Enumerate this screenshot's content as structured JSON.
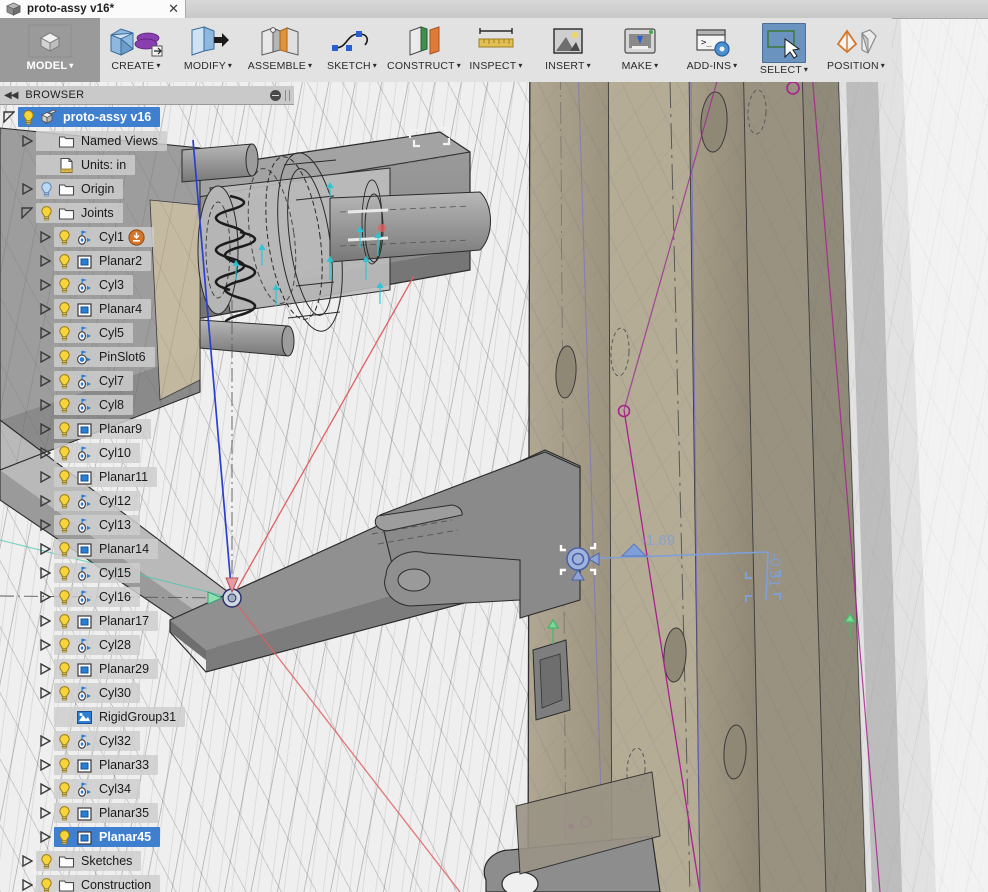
{
  "window": {
    "tab": {
      "title": "proto-assy v16*",
      "doc_icon": "cube-document-icon",
      "close_icon": "close-icon"
    }
  },
  "ribbon": {
    "workspace": {
      "label": "MODEL",
      "icon": "cube-icon",
      "caret": "▾"
    },
    "buttons": [
      {
        "label": "CREATE",
        "icon": "create-solid-icon",
        "caret": "▾",
        "selected": false
      },
      {
        "label": "MODIFY",
        "icon": "modify-press-pull-icon",
        "caret": "▾",
        "selected": false
      },
      {
        "label": "ASSEMBLE",
        "icon": "assemble-joint-icon",
        "caret": "▾",
        "selected": false
      },
      {
        "label": "SKETCH",
        "icon": "sketch-spline-icon",
        "caret": "▾",
        "selected": false
      },
      {
        "label": "CONSTRUCT",
        "icon": "construct-plane-icon",
        "caret": "▾",
        "selected": false
      },
      {
        "label": "INSPECT",
        "icon": "inspect-measure-icon",
        "caret": "▾",
        "selected": false
      },
      {
        "label": "INSERT",
        "icon": "insert-image-icon",
        "caret": "▾",
        "selected": false
      },
      {
        "label": "MAKE",
        "icon": "make-3dprint-icon",
        "caret": "▾",
        "selected": false
      },
      {
        "label": "ADD-INS",
        "icon": "addins-script-icon",
        "caret": "▾",
        "selected": false
      },
      {
        "label": "SELECT",
        "icon": "select-cursor-icon",
        "caret": "▾",
        "selected": true
      },
      {
        "label": "POSITION",
        "icon": "position-move-icon",
        "caret": "▾",
        "selected": false
      }
    ]
  },
  "browser": {
    "title": "BROWSER",
    "collapse_icon": "collapse-left-icon",
    "minimize_icon": "minimize-icon",
    "grip_icon": "panel-grip-icon",
    "nodes": [
      {
        "label": "proto-assy v16",
        "icon": "component-icon",
        "indent": 0,
        "twisty": "open",
        "bulb": true,
        "selected": true,
        "bold": true,
        "badge": null
      },
      {
        "label": "Named Views",
        "icon": "folder-icon",
        "indent": 1,
        "twisty": "closed",
        "bulb": false,
        "selected": false,
        "bold": false,
        "badge": null
      },
      {
        "label": "Units: in",
        "icon": "units-icon",
        "indent": 1,
        "twisty": "none",
        "bulb": false,
        "selected": false,
        "bold": false,
        "badge": null
      },
      {
        "label": "Origin",
        "icon": "folder-icon",
        "indent": 1,
        "twisty": "closed",
        "bulb": "blue",
        "selected": false,
        "bold": false,
        "badge": null
      },
      {
        "label": "Joints",
        "icon": "folder-icon",
        "indent": 1,
        "twisty": "open",
        "bulb": true,
        "selected": false,
        "bold": false,
        "badge": null
      },
      {
        "label": "Cyl1",
        "icon": "cylindrical-joint-icon",
        "indent": 2,
        "twisty": "closed",
        "bulb": true,
        "selected": false,
        "bold": false,
        "badge": "motion-drive-icon"
      },
      {
        "label": "Planar2",
        "icon": "planar-joint-icon",
        "indent": 2,
        "twisty": "closed",
        "bulb": true,
        "selected": false,
        "bold": false,
        "badge": null
      },
      {
        "label": "Cyl3",
        "icon": "cylindrical-joint-icon",
        "indent": 2,
        "twisty": "closed",
        "bulb": true,
        "selected": false,
        "bold": false,
        "badge": null
      },
      {
        "label": "Planar4",
        "icon": "planar-joint-icon",
        "indent": 2,
        "twisty": "closed",
        "bulb": true,
        "selected": false,
        "bold": false,
        "badge": null
      },
      {
        "label": "Cyl5",
        "icon": "cylindrical-joint-icon",
        "indent": 2,
        "twisty": "closed",
        "bulb": true,
        "selected": false,
        "bold": false,
        "badge": null
      },
      {
        "label": "PinSlot6",
        "icon": "pinslot-joint-icon",
        "indent": 2,
        "twisty": "closed",
        "bulb": true,
        "selected": false,
        "bold": false,
        "badge": null
      },
      {
        "label": "Cyl7",
        "icon": "cylindrical-joint-icon",
        "indent": 2,
        "twisty": "closed",
        "bulb": true,
        "selected": false,
        "bold": false,
        "badge": null
      },
      {
        "label": "Cyl8",
        "icon": "cylindrical-joint-icon",
        "indent": 2,
        "twisty": "closed",
        "bulb": true,
        "selected": false,
        "bold": false,
        "badge": null
      },
      {
        "label": "Planar9",
        "icon": "planar-joint-icon",
        "indent": 2,
        "twisty": "closed",
        "bulb": true,
        "selected": false,
        "bold": false,
        "badge": null
      },
      {
        "label": "Cyl10",
        "icon": "cylindrical-joint-icon",
        "indent": 2,
        "twisty": "closed",
        "bulb": true,
        "selected": false,
        "bold": false,
        "badge": null
      },
      {
        "label": "Planar11",
        "icon": "planar-joint-icon",
        "indent": 2,
        "twisty": "closed",
        "bulb": true,
        "selected": false,
        "bold": false,
        "badge": null
      },
      {
        "label": "Cyl12",
        "icon": "cylindrical-joint-icon",
        "indent": 2,
        "twisty": "closed",
        "bulb": true,
        "selected": false,
        "bold": false,
        "badge": null
      },
      {
        "label": "Cyl13",
        "icon": "cylindrical-joint-icon",
        "indent": 2,
        "twisty": "closed",
        "bulb": true,
        "selected": false,
        "bold": false,
        "badge": null
      },
      {
        "label": "Planar14",
        "icon": "planar-joint-icon",
        "indent": 2,
        "twisty": "closed",
        "bulb": true,
        "selected": false,
        "bold": false,
        "badge": null
      },
      {
        "label": "Cyl15",
        "icon": "cylindrical-joint-icon",
        "indent": 2,
        "twisty": "closed",
        "bulb": true,
        "selected": false,
        "bold": false,
        "badge": null
      },
      {
        "label": "Cyl16",
        "icon": "cylindrical-joint-icon",
        "indent": 2,
        "twisty": "closed",
        "bulb": true,
        "selected": false,
        "bold": false,
        "badge": null
      },
      {
        "label": "Planar17",
        "icon": "planar-joint-icon",
        "indent": 2,
        "twisty": "closed",
        "bulb": true,
        "selected": false,
        "bold": false,
        "badge": null
      },
      {
        "label": "Cyl28",
        "icon": "cylindrical-joint-icon",
        "indent": 2,
        "twisty": "closed",
        "bulb": true,
        "selected": false,
        "bold": false,
        "badge": null
      },
      {
        "label": "Planar29",
        "icon": "planar-joint-icon",
        "indent": 2,
        "twisty": "closed",
        "bulb": true,
        "selected": false,
        "bold": false,
        "badge": null
      },
      {
        "label": "Cyl30",
        "icon": "cylindrical-joint-icon",
        "indent": 2,
        "twisty": "closed",
        "bulb": true,
        "selected": false,
        "bold": false,
        "badge": null
      },
      {
        "label": "RigidGroup31",
        "icon": "rigid-group-icon",
        "indent": 2,
        "twisty": "none",
        "bulb": false,
        "selected": false,
        "bold": false,
        "badge": null
      },
      {
        "label": "Cyl32",
        "icon": "cylindrical-joint-icon",
        "indent": 2,
        "twisty": "closed",
        "bulb": true,
        "selected": false,
        "bold": false,
        "badge": null
      },
      {
        "label": "Planar33",
        "icon": "planar-joint-icon",
        "indent": 2,
        "twisty": "closed",
        "bulb": true,
        "selected": false,
        "bold": false,
        "badge": null
      },
      {
        "label": "Cyl34",
        "icon": "cylindrical-joint-icon",
        "indent": 2,
        "twisty": "closed",
        "bulb": true,
        "selected": false,
        "bold": false,
        "badge": null
      },
      {
        "label": "Planar35",
        "icon": "planar-joint-icon",
        "indent": 2,
        "twisty": "closed",
        "bulb": true,
        "selected": false,
        "bold": false,
        "badge": null
      },
      {
        "label": "Planar45",
        "icon": "planar-joint-icon",
        "indent": 2,
        "twisty": "closed",
        "bulb": true,
        "selected": true,
        "bold": true,
        "badge": null
      },
      {
        "label": "Sketches",
        "icon": "folder-icon",
        "indent": 1,
        "twisty": "closed",
        "bulb": true,
        "selected": false,
        "bold": false,
        "badge": null
      },
      {
        "label": "Construction",
        "icon": "folder-icon",
        "indent": 1,
        "twisty": "closed",
        "bulb": true,
        "selected": false,
        "bold": false,
        "badge": null
      }
    ]
  },
  "viewport": {
    "joint_manipulator": {
      "name": "planar-joint-manipulator",
      "horizontal_dimension": "-1.69",
      "vertical_dimension": "-0.51",
      "arrow_icon": "drag-arrow-icon",
      "handle_icon": "planar-joint-handle-icon"
    },
    "origin_marker": {
      "name": "origin-triad-icon"
    },
    "colors": {
      "background": "#efefef",
      "body_gray": "#8f8f8f",
      "beam_tan": "#a9a08c",
      "selection_blue": "#3f7fd0",
      "x_axis_red": "#e06060",
      "y_axis_green": "#5ec98a",
      "z_axis_blue": "#2a3fd0",
      "sketch_magenta": "#a8228c",
      "sketch_orange": "#e08a2a"
    }
  }
}
